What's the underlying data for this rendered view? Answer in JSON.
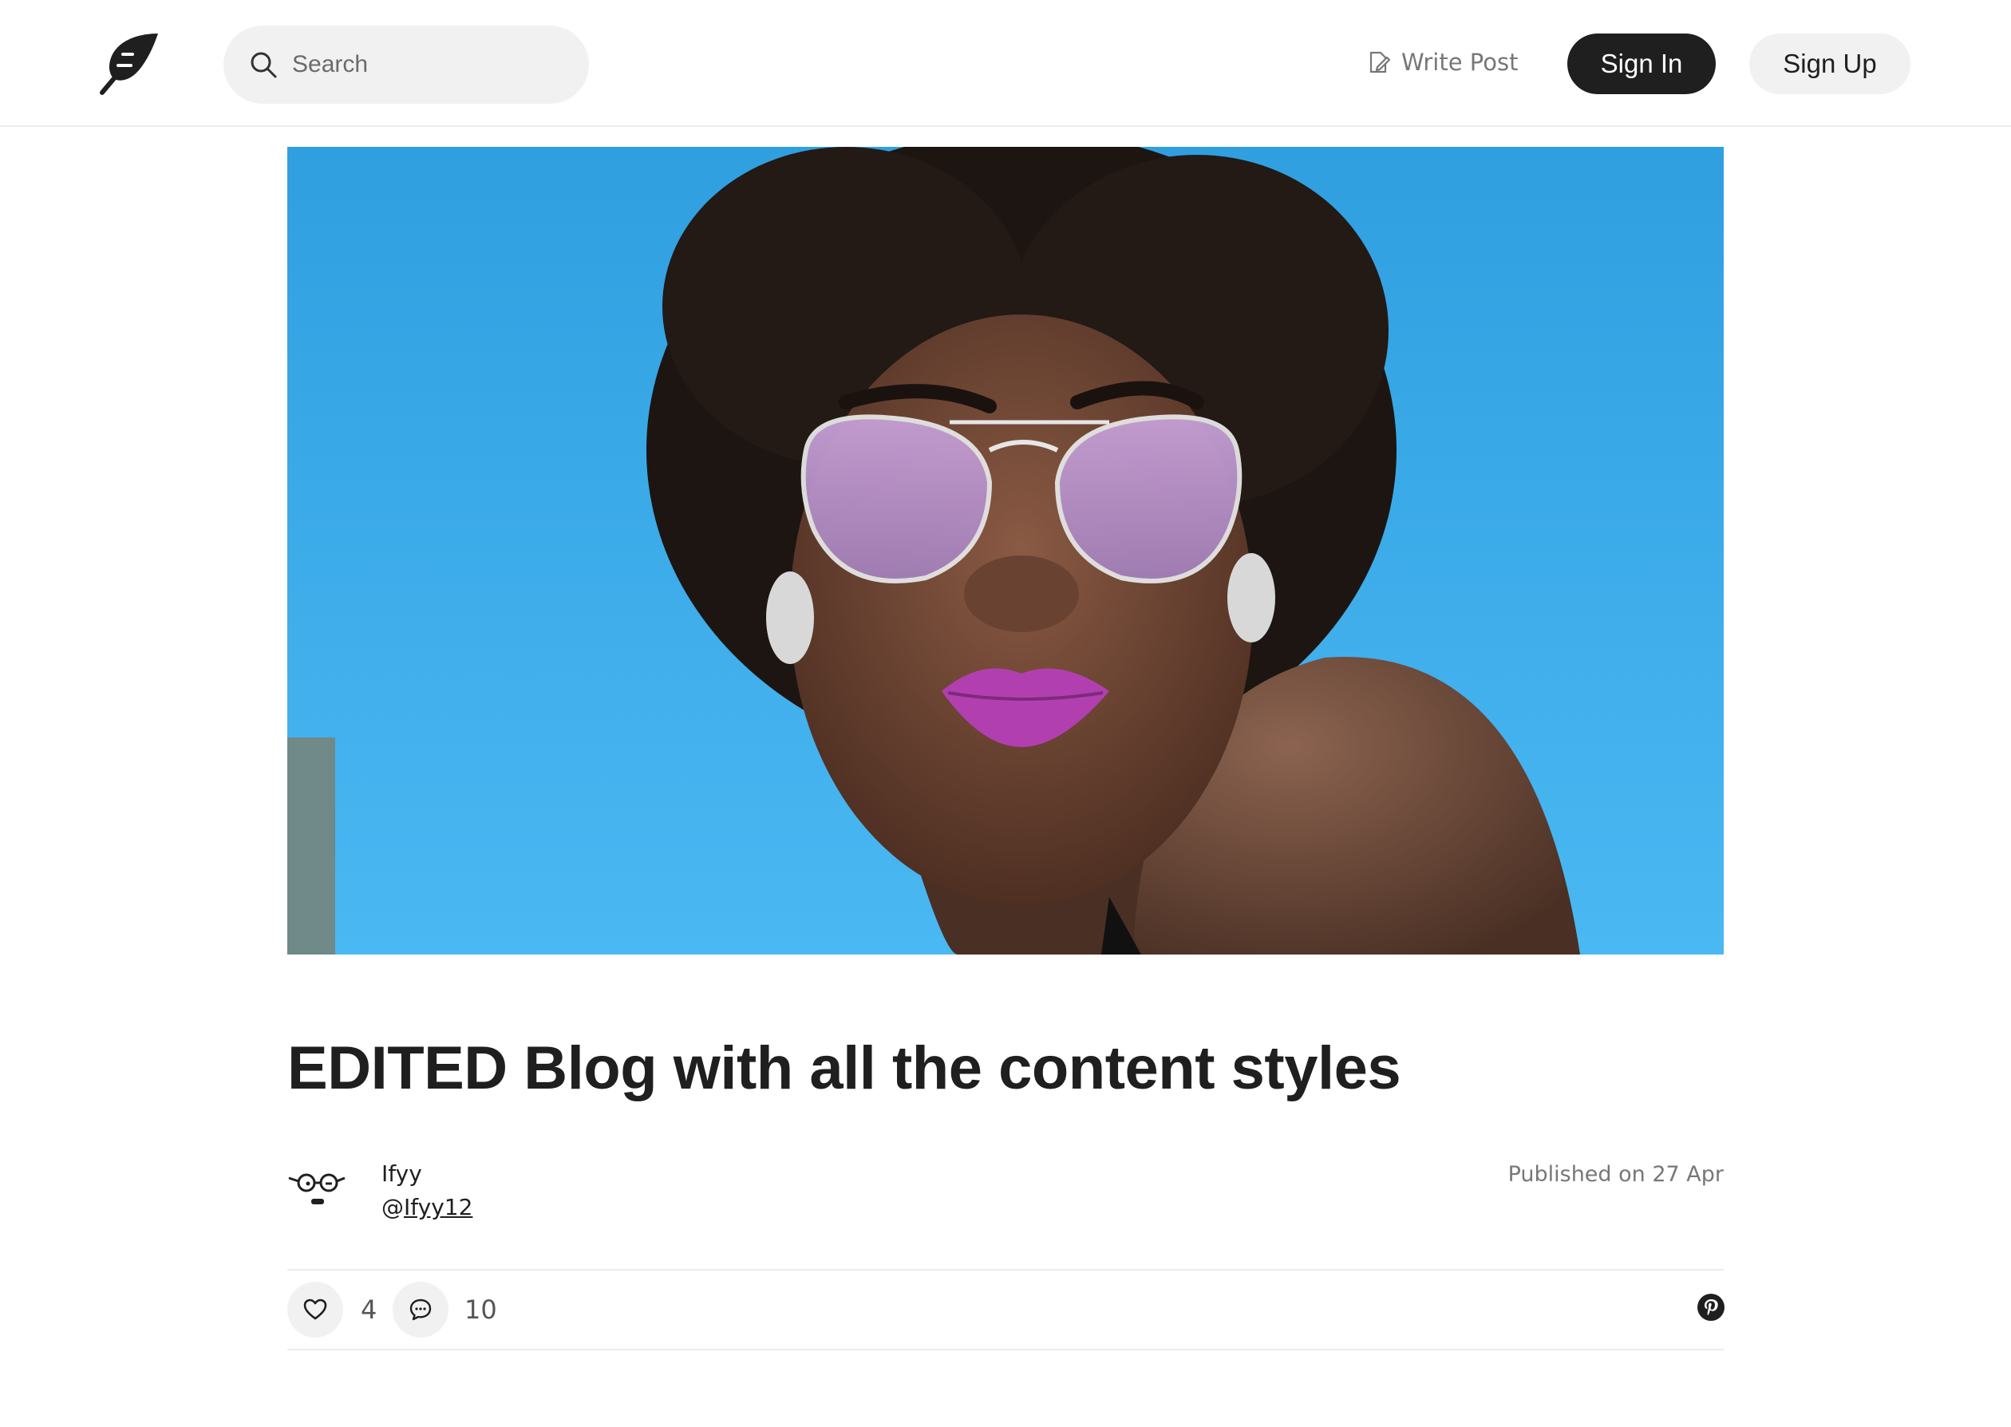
{
  "header": {
    "search_placeholder": "Search",
    "write_post_label": "Write Post",
    "sign_in_label": "Sign In",
    "sign_up_label": "Sign Up"
  },
  "post": {
    "title": "EDITED Blog with all the content styles",
    "author_name": "Ifyy",
    "author_handle_prefix": "@",
    "author_handle": "Ifyy12",
    "published": "Published on 27 Apr",
    "likes": "4",
    "comments": "10"
  },
  "colors": {
    "primary_button": "#1f1f1f",
    "secondary_button": "#f1f1f1",
    "sky": "#3aa8e8",
    "lips": "#b23fb0"
  },
  "icons": {
    "logo": "feather-leaf-icon",
    "search": "search-icon",
    "write": "edit-icon",
    "like": "heart-icon",
    "comment": "comment-icon",
    "share": "pinterest-icon"
  }
}
